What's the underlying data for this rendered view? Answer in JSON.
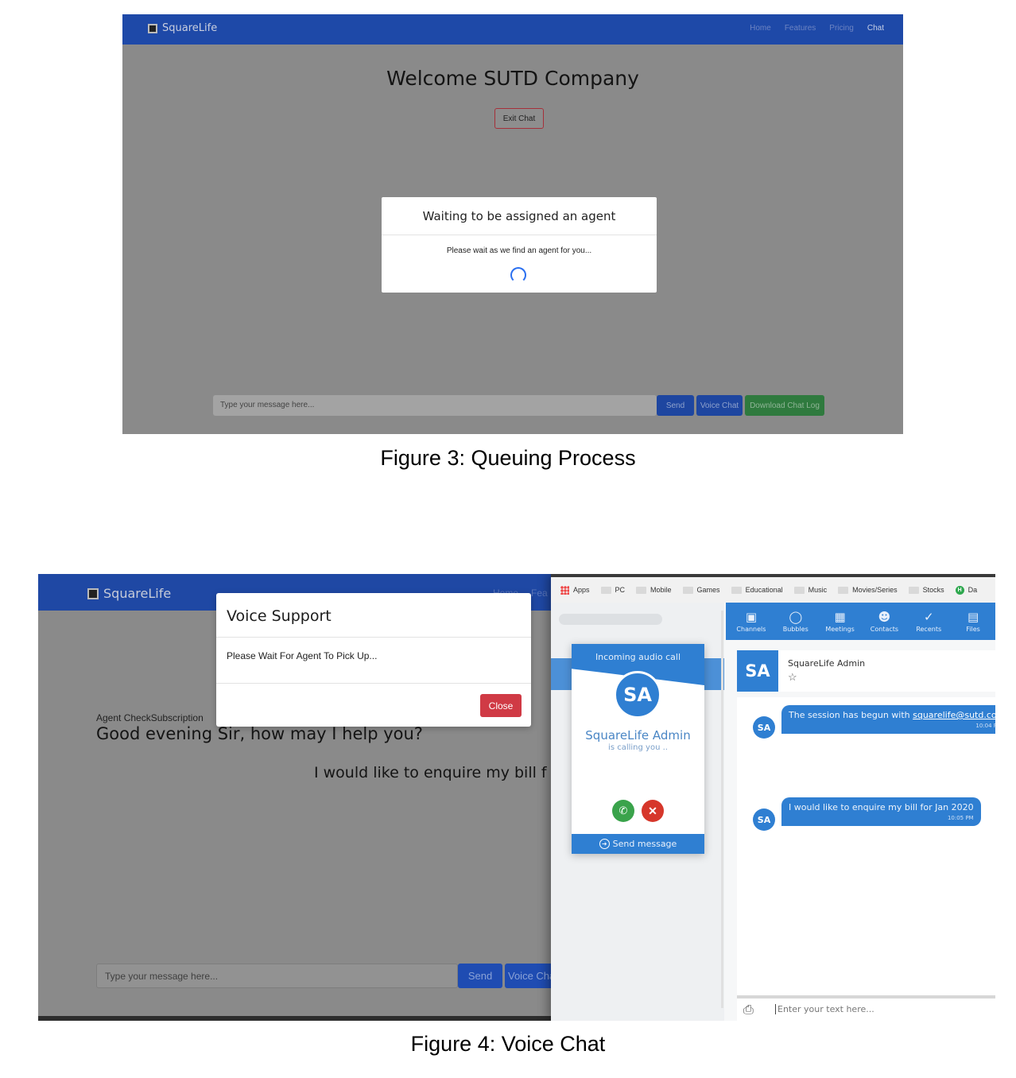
{
  "figure3": {
    "brand": "SquareLife",
    "nav_links": [
      "Home",
      "Features",
      "Pricing",
      "Chat"
    ],
    "welcome_title": "Welcome SUTD Company",
    "exit_button": "Exit Chat",
    "modal_title": "Waiting to be assigned an agent",
    "modal_body": "Please wait as we find an agent for you...",
    "input_placeholder": "Type your message here...",
    "send_button": "Send",
    "voice_button": "Voice Chat",
    "download_button": "Download Chat Log",
    "caption": "Figure 3: Queuing Process"
  },
  "figure4": {
    "brand": "SquareLife",
    "nav_links": [
      "Home",
      "Fea"
    ],
    "modal_title": "Voice Support",
    "modal_body": "Please Wait For Agent To Pick Up...",
    "close_button": "Close",
    "sender_label": "Agent CheckSubscription",
    "agent_message": "Good evening Sir, how may I help you?",
    "user_message": "I would like to enquire my bill f",
    "input_placeholder": "Type your message here...",
    "send_button": "Send",
    "voice_button": "Voice Cha",
    "caption": "Figure 4: Voice Chat"
  },
  "rainbow": {
    "bookmarks": [
      "Apps",
      "PC",
      "Mobile",
      "Games",
      "Educational",
      "Music",
      "Movies/Series",
      "Stocks",
      "Da"
    ],
    "toolbar": [
      "Channels",
      "Bubbles",
      "Meetings",
      "Contacts",
      "Recents",
      "Files"
    ],
    "call": {
      "title": "Incoming audio call",
      "initials": "SA",
      "name": "SquareLife Admin",
      "status": "is calling you ..",
      "send_message": "Send message"
    },
    "header": {
      "initials": "SA",
      "name": "SquareLife Admin"
    },
    "messages": [
      {
        "initials": "SA",
        "text_prefix": "The session has begun with ",
        "link": "squarelife@sutd.com",
        "time": "10:04 P"
      },
      {
        "initials": "SA",
        "text": "I would like to enquire my bill for Jan 2020",
        "time": "10:05 PM"
      }
    ],
    "composer_placeholder": "Enter your text here..."
  },
  "colors": {
    "nav_blue": "#1e49a8",
    "rainbow_blue": "#2f7fd2",
    "danger": "#d03a45",
    "success": "#2f7a3e"
  }
}
